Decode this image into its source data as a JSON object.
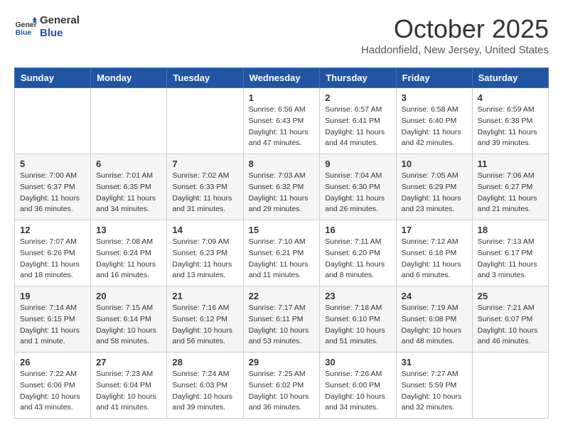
{
  "header": {
    "logo_line1": "General",
    "logo_line2": "Blue",
    "month": "October 2025",
    "location": "Haddonfield, New Jersey, United States"
  },
  "weekdays": [
    "Sunday",
    "Monday",
    "Tuesday",
    "Wednesday",
    "Thursday",
    "Friday",
    "Saturday"
  ],
  "weeks": [
    [
      {
        "day": "",
        "info": ""
      },
      {
        "day": "",
        "info": ""
      },
      {
        "day": "",
        "info": ""
      },
      {
        "day": "1",
        "info": "Sunrise: 6:56 AM\nSunset: 6:43 PM\nDaylight: 11 hours\nand 47 minutes."
      },
      {
        "day": "2",
        "info": "Sunrise: 6:57 AM\nSunset: 6:41 PM\nDaylight: 11 hours\nand 44 minutes."
      },
      {
        "day": "3",
        "info": "Sunrise: 6:58 AM\nSunset: 6:40 PM\nDaylight: 11 hours\nand 42 minutes."
      },
      {
        "day": "4",
        "info": "Sunrise: 6:59 AM\nSunset: 6:38 PM\nDaylight: 11 hours\nand 39 minutes."
      }
    ],
    [
      {
        "day": "5",
        "info": "Sunrise: 7:00 AM\nSunset: 6:37 PM\nDaylight: 11 hours\nand 36 minutes."
      },
      {
        "day": "6",
        "info": "Sunrise: 7:01 AM\nSunset: 6:35 PM\nDaylight: 11 hours\nand 34 minutes."
      },
      {
        "day": "7",
        "info": "Sunrise: 7:02 AM\nSunset: 6:33 PM\nDaylight: 11 hours\nand 31 minutes."
      },
      {
        "day": "8",
        "info": "Sunrise: 7:03 AM\nSunset: 6:32 PM\nDaylight: 11 hours\nand 29 minutes."
      },
      {
        "day": "9",
        "info": "Sunrise: 7:04 AM\nSunset: 6:30 PM\nDaylight: 11 hours\nand 26 minutes."
      },
      {
        "day": "10",
        "info": "Sunrise: 7:05 AM\nSunset: 6:29 PM\nDaylight: 11 hours\nand 23 minutes."
      },
      {
        "day": "11",
        "info": "Sunrise: 7:06 AM\nSunset: 6:27 PM\nDaylight: 11 hours\nand 21 minutes."
      }
    ],
    [
      {
        "day": "12",
        "info": "Sunrise: 7:07 AM\nSunset: 6:26 PM\nDaylight: 11 hours\nand 18 minutes."
      },
      {
        "day": "13",
        "info": "Sunrise: 7:08 AM\nSunset: 6:24 PM\nDaylight: 11 hours\nand 16 minutes."
      },
      {
        "day": "14",
        "info": "Sunrise: 7:09 AM\nSunset: 6:23 PM\nDaylight: 11 hours\nand 13 minutes."
      },
      {
        "day": "15",
        "info": "Sunrise: 7:10 AM\nSunset: 6:21 PM\nDaylight: 11 hours\nand 11 minutes."
      },
      {
        "day": "16",
        "info": "Sunrise: 7:11 AM\nSunset: 6:20 PM\nDaylight: 11 hours\nand 8 minutes."
      },
      {
        "day": "17",
        "info": "Sunrise: 7:12 AM\nSunset: 6:18 PM\nDaylight: 11 hours\nand 6 minutes."
      },
      {
        "day": "18",
        "info": "Sunrise: 7:13 AM\nSunset: 6:17 PM\nDaylight: 11 hours\nand 3 minutes."
      }
    ],
    [
      {
        "day": "19",
        "info": "Sunrise: 7:14 AM\nSunset: 6:15 PM\nDaylight: 11 hours\nand 1 minute."
      },
      {
        "day": "20",
        "info": "Sunrise: 7:15 AM\nSunset: 6:14 PM\nDaylight: 10 hours\nand 58 minutes."
      },
      {
        "day": "21",
        "info": "Sunrise: 7:16 AM\nSunset: 6:12 PM\nDaylight: 10 hours\nand 56 minutes."
      },
      {
        "day": "22",
        "info": "Sunrise: 7:17 AM\nSunset: 6:11 PM\nDaylight: 10 hours\nand 53 minutes."
      },
      {
        "day": "23",
        "info": "Sunrise: 7:18 AM\nSunset: 6:10 PM\nDaylight: 10 hours\nand 51 minutes."
      },
      {
        "day": "24",
        "info": "Sunrise: 7:19 AM\nSunset: 6:08 PM\nDaylight: 10 hours\nand 48 minutes."
      },
      {
        "day": "25",
        "info": "Sunrise: 7:21 AM\nSunset: 6:07 PM\nDaylight: 10 hours\nand 46 minutes."
      }
    ],
    [
      {
        "day": "26",
        "info": "Sunrise: 7:22 AM\nSunset: 6:06 PM\nDaylight: 10 hours\nand 43 minutes."
      },
      {
        "day": "27",
        "info": "Sunrise: 7:23 AM\nSunset: 6:04 PM\nDaylight: 10 hours\nand 41 minutes."
      },
      {
        "day": "28",
        "info": "Sunrise: 7:24 AM\nSunset: 6:03 PM\nDaylight: 10 hours\nand 39 minutes."
      },
      {
        "day": "29",
        "info": "Sunrise: 7:25 AM\nSunset: 6:02 PM\nDaylight: 10 hours\nand 36 minutes."
      },
      {
        "day": "30",
        "info": "Sunrise: 7:26 AM\nSunset: 6:00 PM\nDaylight: 10 hours\nand 34 minutes."
      },
      {
        "day": "31",
        "info": "Sunrise: 7:27 AM\nSunset: 5:59 PM\nDaylight: 10 hours\nand 32 minutes."
      },
      {
        "day": "",
        "info": ""
      }
    ]
  ]
}
